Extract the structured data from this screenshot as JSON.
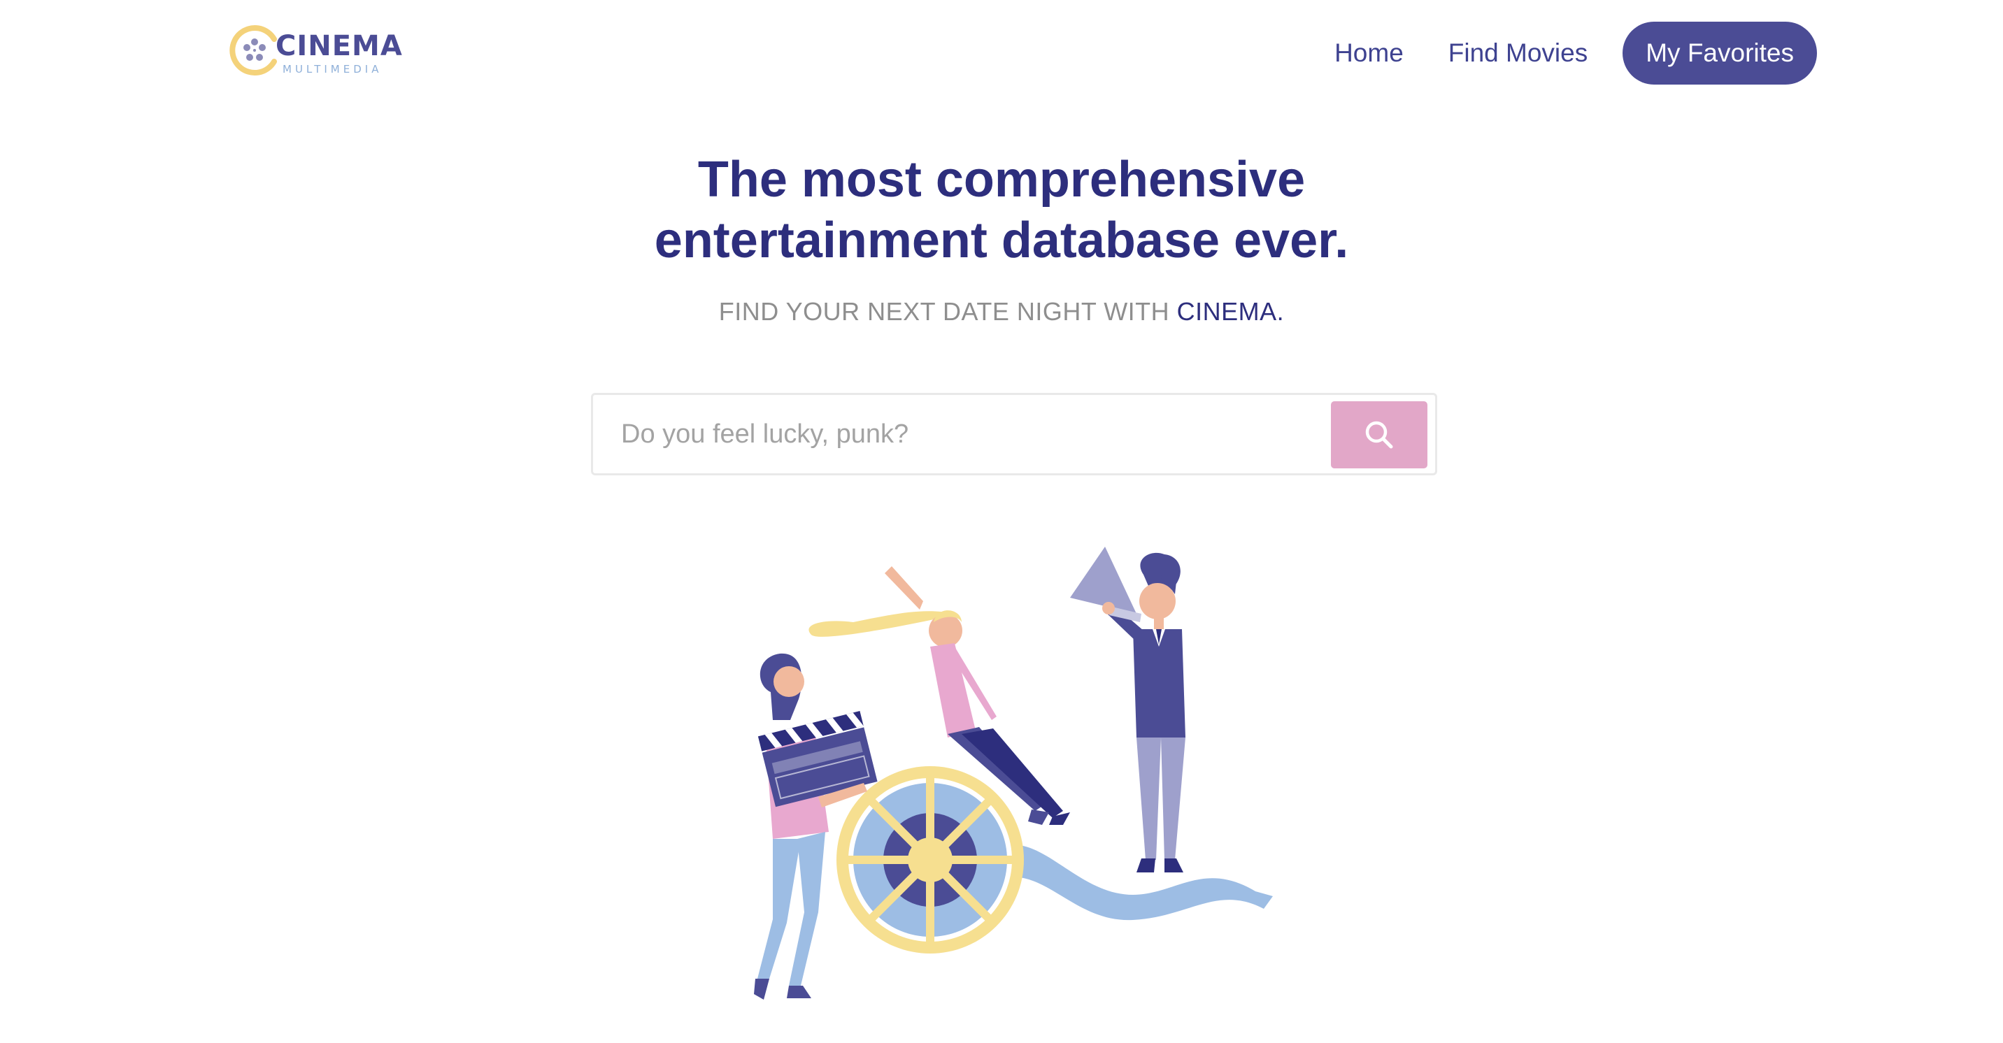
{
  "brand": {
    "name": "CINEMA",
    "subtitle": "MULTIMEDIA"
  },
  "nav": {
    "home": "Home",
    "find_movies": "Find Movies",
    "favorites": "My Favorites"
  },
  "hero": {
    "headline_line1": "The most comprehensive",
    "headline_line2": "entertainment database ever.",
    "tagline_prefix": "FIND YOUR NEXT DATE NIGHT WITH ",
    "tagline_brand": "CINEMA.",
    "search_placeholder": "Do you feel lucky, punk?",
    "search_value": ""
  },
  "icons": {
    "logo": "film-reel-logo-icon",
    "search": "magnifier-search-icon"
  },
  "colors": {
    "primary": "#4b4c95",
    "headline": "#2d2e7d",
    "tagline": "#8e8e8e",
    "search_button": "#e2a7c8",
    "reel": "#f6df90",
    "reel_inner": "#9dbde4",
    "figure_pink": "#e8a8cf",
    "figure_navy": "#4b4c95"
  }
}
